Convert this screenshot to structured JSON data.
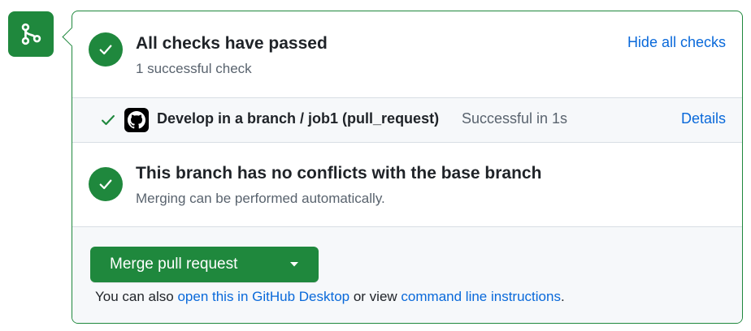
{
  "colors": {
    "success_green": "#1f883d",
    "link_blue": "#0969da",
    "muted_text": "#59636e",
    "panel_bg_alt": "#f6f8fa"
  },
  "sidebar": {
    "icon": "git-merge-icon"
  },
  "checks": {
    "title": "All checks have passed",
    "subtitle": "1 successful check",
    "toggle_label": "Hide all checks",
    "icon": "check-circle-icon"
  },
  "job": {
    "name": "Develop in a branch / job1 (pull_request)",
    "status": "Successful in 1s",
    "details_label": "Details",
    "avatar_icon": "github-logo-icon",
    "status_icon": "check-icon"
  },
  "conflicts": {
    "title": "This branch has no conflicts with the base branch",
    "subtitle": "Merging can be performed automatically.",
    "icon": "check-circle-icon"
  },
  "merge": {
    "button_label": "Merge pull request",
    "caret_icon": "triangle-down-icon",
    "note_prefix": "You can also ",
    "note_link1": "open this in GitHub Desktop",
    "note_middle": " or view ",
    "note_link2": "command line instructions",
    "note_suffix": "."
  }
}
